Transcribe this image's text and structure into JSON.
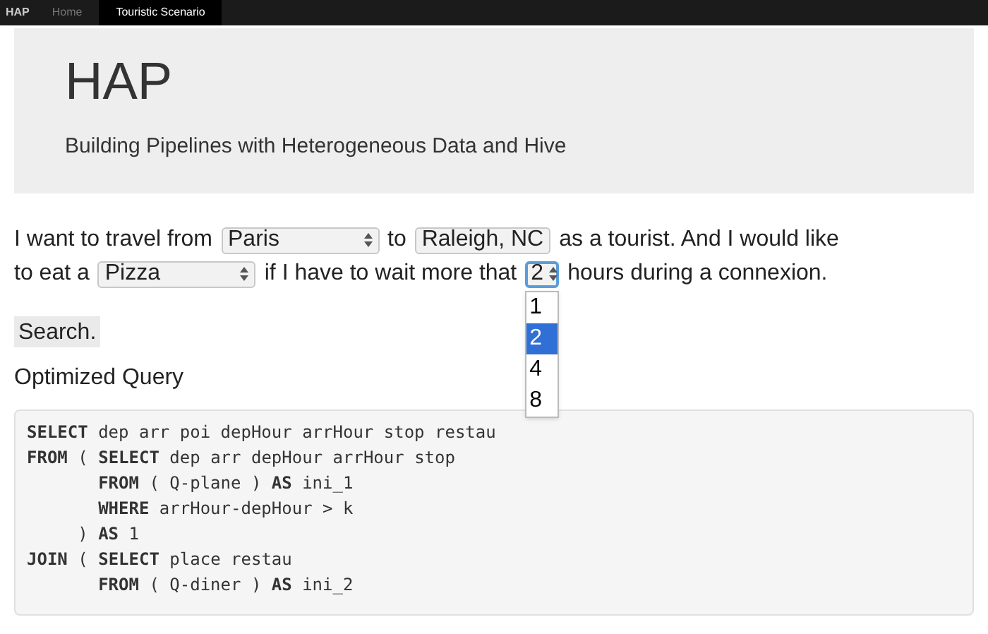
{
  "navbar": {
    "brand": "HAP",
    "links": [
      {
        "label": "Home",
        "selected": false
      },
      {
        "label": "Touristic Scenario",
        "selected": true
      }
    ]
  },
  "header": {
    "title": "HAP",
    "subtitle": "Building Pipelines with Heterogeneous Data and Hive"
  },
  "form": {
    "lines": [
      [
        {
          "kind": "text",
          "text": "I want to travel from"
        },
        {
          "kind": "select",
          "value": "Paris",
          "focused": false
        },
        {
          "kind": "text",
          "text": "to"
        },
        {
          "kind": "box",
          "value": "Raleigh, NC",
          "focused": false
        },
        {
          "kind": "text",
          "text": "as a tourist. And I would like"
        }
      ],
      [
        {
          "kind": "text",
          "text": "to eat a"
        },
        {
          "kind": "select",
          "value": "Pizza",
          "focused": false
        },
        {
          "kind": "text",
          "text": "if I have to wait more that"
        },
        {
          "kind": "select",
          "value": "2",
          "focused": true,
          "options": [
            {
              "label": "1",
              "selected": false
            },
            {
              "label": "2",
              "selected": true
            },
            {
              "label": "4",
              "selected": false
            },
            {
              "label": "8",
              "selected": false
            }
          ]
        },
        {
          "kind": "text",
          "text": "hours during a connexion."
        }
      ]
    ],
    "search_button": "Search."
  },
  "query": {
    "heading": "Optimized Query",
    "code_lines": [
      "**SELECT** dep arr poi depHour arrHour stop restau",
      "**FROM** ( **SELECT** dep arr depHour arrHour stop",
      "       **FROM** ( Q-plane ) **AS** ini_1",
      "       **WHERE** arrHour-depHour > k",
      "     ) **AS** 1",
      "**JOIN** ( **SELECT** place restau",
      "       **FROM** ( Q-diner ) **AS** ini_2"
    ]
  }
}
